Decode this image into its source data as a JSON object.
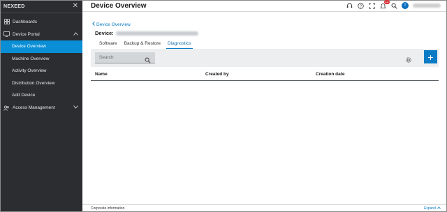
{
  "sidebar": {
    "brand": "NEXEED",
    "items": [
      {
        "label": "Dashboards"
      },
      {
        "label": "Device Portal"
      },
      {
        "label": "Access Management"
      }
    ],
    "device_portal_children": [
      {
        "label": "Device Overview"
      },
      {
        "label": "Machine Overview"
      },
      {
        "label": "Activity Overview"
      },
      {
        "label": "Distribution Overview"
      },
      {
        "label": "Add Device"
      }
    ]
  },
  "header": {
    "title": "Device Overview",
    "notification_count": "12",
    "avatar_initial": "T"
  },
  "main": {
    "back_link": "Device Overview",
    "device_label": "Device:",
    "tabs": [
      {
        "label": "Software"
      },
      {
        "label": "Backup & Restore"
      },
      {
        "label": "Diagnostics"
      }
    ],
    "search_placeholder": "Search",
    "add_label": "+",
    "columns": [
      "Name",
      "Created by",
      "Creation date"
    ]
  },
  "footer": {
    "left": "Corporate information",
    "expand": "Expand"
  },
  "colors": {
    "accent": "#0a7bc4",
    "sidebar_bg": "#2b2d30",
    "active_item": "#0a8fd6"
  }
}
